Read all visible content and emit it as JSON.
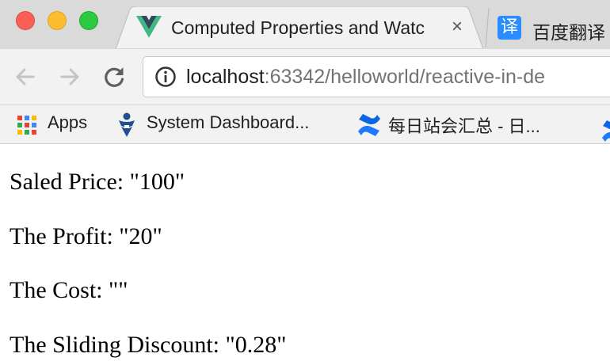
{
  "window": {
    "controls": [
      "close",
      "minimize",
      "maximize"
    ]
  },
  "tabs": [
    {
      "title": "Computed Properties and Watc",
      "icon": "vue-logo-icon",
      "active": true,
      "close_label": "×"
    },
    {
      "title": "百度翻译",
      "icon": "baidu-translate-icon",
      "icon_text": "译",
      "active": false
    }
  ],
  "toolbar": {
    "url_host": "localhost",
    "url_rest": ":63342/helloworld/reactive-in-de"
  },
  "bookmarks": [
    {
      "label": "Apps",
      "icon": "apps-grid-icon"
    },
    {
      "label": "System Dashboard...",
      "icon": "jira-icon"
    },
    {
      "label": "每日站会汇总 - 日...",
      "icon": "confluence-icon"
    }
  ],
  "content": {
    "lines": [
      "Saled Price: \"100\"",
      "The Profit: \"20\"",
      "The Cost: \"\"",
      "The Sliding Discount: \"0.28\""
    ]
  },
  "colors": {
    "tabbar": "#dadada",
    "toolbar": "#f2f2f2",
    "close": "#fc5f57",
    "minimize": "#fdbc2e",
    "maximize": "#29c940",
    "vue_green": "#41b883",
    "vue_dark": "#35495e",
    "baidu_blue": "#2b8cff",
    "confluence_blue": "#1d7afc"
  }
}
